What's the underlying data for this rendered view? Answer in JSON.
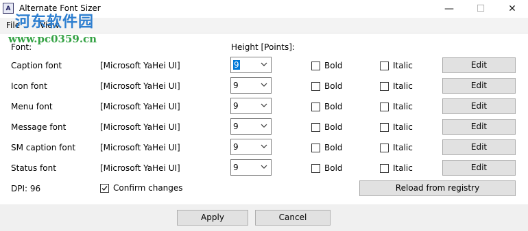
{
  "window": {
    "title": "Alternate Font Sizer",
    "app_icon_text": "A",
    "minimize_glyph": "—",
    "maximize_glyph": "☐",
    "close_glyph": "✕"
  },
  "menu": {
    "file": "File",
    "view": "View"
  },
  "watermark": {
    "line1": "河东软件园",
    "line2": "www.pc0359.cn"
  },
  "headers": {
    "font": "Font:",
    "height": "Height [Points]:"
  },
  "rows": [
    {
      "label": "Caption font",
      "font": "[Microsoft YaHei UI]",
      "size": "9",
      "bold_label": "Bold",
      "italic_label": "Italic",
      "edit_label": "Edit",
      "bold": false,
      "italic": false
    },
    {
      "label": "Icon font",
      "font": "[Microsoft YaHei UI]",
      "size": "9",
      "bold_label": "Bold",
      "italic_label": "Italic",
      "edit_label": "Edit",
      "bold": false,
      "italic": false
    },
    {
      "label": "Menu font",
      "font": "[Microsoft YaHei UI]",
      "size": "9",
      "bold_label": "Bold",
      "italic_label": "Italic",
      "edit_label": "Edit",
      "bold": false,
      "italic": false
    },
    {
      "label": "Message font",
      "font": "[Microsoft YaHei UI]",
      "size": "9",
      "bold_label": "Bold",
      "italic_label": "Italic",
      "edit_label": "Edit",
      "bold": false,
      "italic": false
    },
    {
      "label": "SM caption font",
      "font": "[Microsoft YaHei UI]",
      "size": "9",
      "bold_label": "Bold",
      "italic_label": "Italic",
      "edit_label": "Edit",
      "bold": false,
      "italic": false
    },
    {
      "label": "Status font",
      "font": "[Microsoft YaHei UI]",
      "size": "9",
      "bold_label": "Bold",
      "italic_label": "Italic",
      "edit_label": "Edit",
      "bold": false,
      "italic": false
    }
  ],
  "dpi": "DPI: 96",
  "confirm": {
    "label": "Confirm changes",
    "checked": true
  },
  "reload_label": "Reload from registry",
  "footer": {
    "apply": "Apply",
    "cancel": "Cancel"
  },
  "colors": {
    "selection": "#0078d7",
    "watermark_blue": "#2e7fd0",
    "watermark_green": "#34a244"
  }
}
